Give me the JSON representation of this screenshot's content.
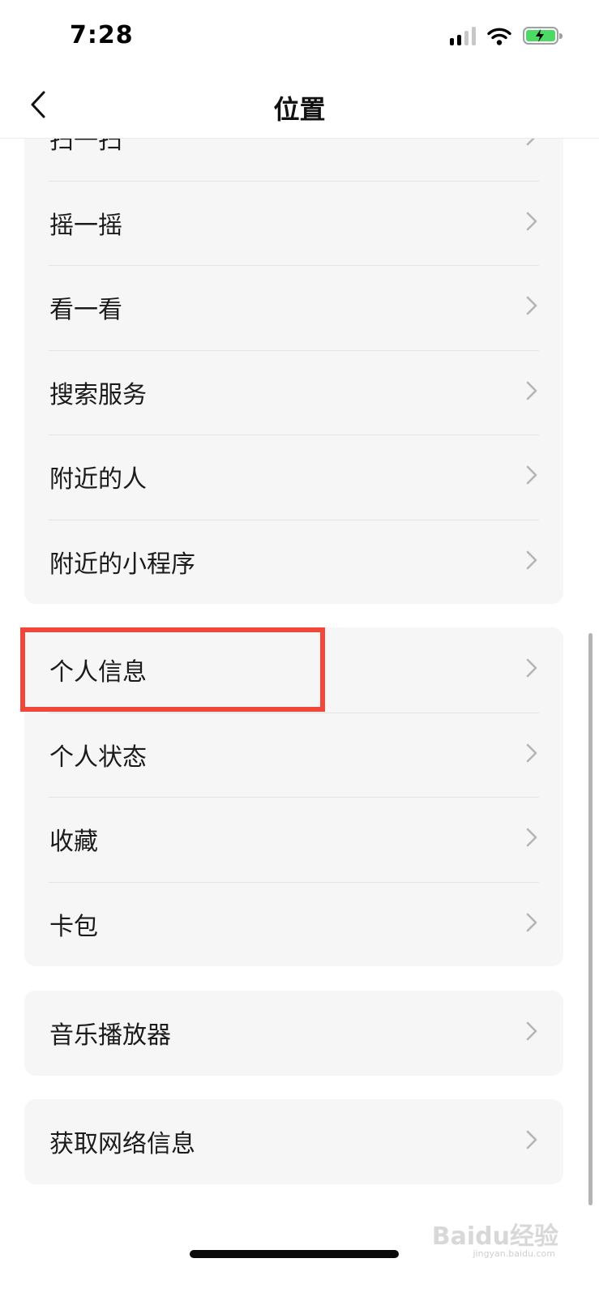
{
  "status_bar": {
    "time": "7:28",
    "signal_bars": 2,
    "battery_color": "#4cd964"
  },
  "nav": {
    "title": "位置",
    "back_icon": "chevron-left-icon"
  },
  "groups": [
    {
      "items": [
        {
          "label": "扫一扫"
        },
        {
          "label": "摇一摇"
        },
        {
          "label": "看一看"
        },
        {
          "label": "搜索服务"
        },
        {
          "label": "附近的人"
        },
        {
          "label": "附近的小程序"
        }
      ]
    },
    {
      "items": [
        {
          "label": "个人信息"
        },
        {
          "label": "个人状态"
        },
        {
          "label": "收藏"
        },
        {
          "label": "卡包"
        }
      ]
    },
    {
      "items": [
        {
          "label": "音乐播放器"
        }
      ]
    },
    {
      "items": [
        {
          "label": "获取网络信息"
        }
      ]
    }
  ],
  "highlight": {
    "target": "个人信息",
    "color": "#f0473a"
  },
  "watermark": {
    "text": "Baidu经验",
    "sub": "jingyan.baidu.com"
  }
}
